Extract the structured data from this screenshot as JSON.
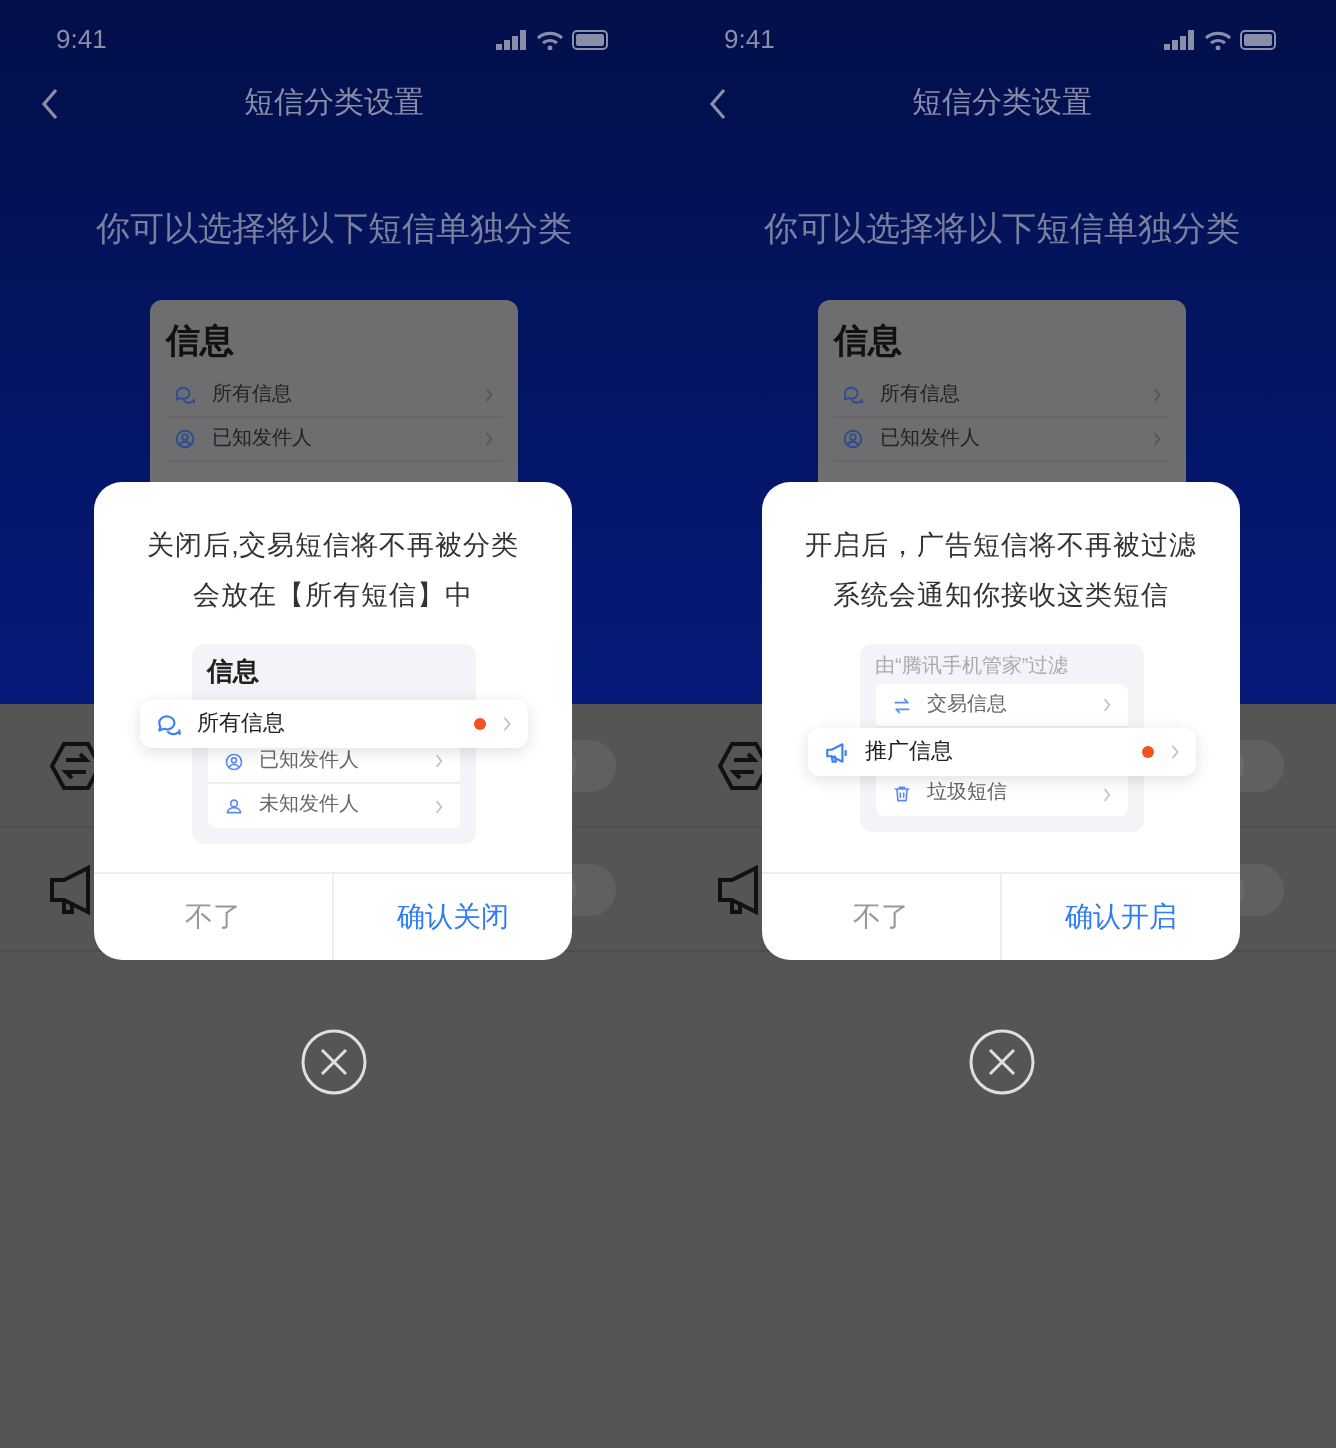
{
  "screens": [
    {
      "status_time": "9:41",
      "nav": {
        "title": "短信分类设置"
      },
      "subtitle": "你可以选择将以下短信单独分类",
      "preview_card": {
        "title": "信息",
        "items": [
          {
            "kind": "chat",
            "label": "所有信息"
          },
          {
            "kind": "person",
            "label": "已知发件人"
          }
        ]
      },
      "settings_rows": [
        {
          "kind": "exchange",
          "on": false
        },
        {
          "kind": "megaphone",
          "on": false
        }
      ],
      "dialog": {
        "message_lines": [
          "关闭后,交易短信将不再被分类",
          "会放在【所有短信】中"
        ],
        "illustration": {
          "heading": "信息",
          "highlighted": {
            "kind": "chat",
            "label": "所有信息",
            "unread": true
          },
          "after": [
            {
              "kind": "person",
              "label": "已知发件人"
            },
            {
              "kind": "person-plus",
              "label": "未知发件人"
            }
          ]
        },
        "buttons": [
          {
            "kind": "cancel",
            "label": "不了"
          },
          {
            "kind": "confirm",
            "label": "确认关闭"
          }
        ]
      }
    },
    {
      "status_time": "9:41",
      "nav": {
        "title": "短信分类设置"
      },
      "subtitle": "你可以选择将以下短信单独分类",
      "preview_card": {
        "title": "信息",
        "items": [
          {
            "kind": "chat",
            "label": "所有信息"
          },
          {
            "kind": "person",
            "label": "已知发件人"
          }
        ]
      },
      "settings_rows": [
        {
          "kind": "exchange",
          "on": false
        },
        {
          "kind": "megaphone",
          "on": false
        }
      ],
      "dialog": {
        "message_lines": [
          "开启后，广告短信将不再被过滤",
          "系统会通知你接收这类短信"
        ],
        "illustration": {
          "caption": "由“腾讯手机管家”过滤",
          "before": [
            {
              "kind": "exchange",
              "label": "交易信息"
            }
          ],
          "highlighted": {
            "kind": "megaphone",
            "label": "推广信息",
            "unread": true
          },
          "after": [
            {
              "kind": "trash",
              "label": "垃圾短信"
            }
          ]
        },
        "buttons": [
          {
            "kind": "cancel",
            "label": "不了"
          },
          {
            "kind": "confirm",
            "label": "确认开启"
          }
        ]
      }
    }
  ]
}
